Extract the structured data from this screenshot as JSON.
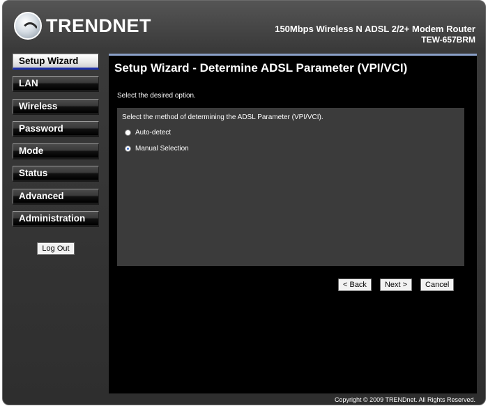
{
  "header": {
    "logo_text": "TRENDNET",
    "product_name": "150Mbps Wireless N ADSL 2/2+ Modem Router",
    "model": "TEW-657BRM"
  },
  "sidebar": {
    "items": [
      {
        "label": "Setup Wizard",
        "active": true
      },
      {
        "label": "LAN"
      },
      {
        "label": "Wireless"
      },
      {
        "label": "Password"
      },
      {
        "label": "Mode"
      },
      {
        "label": "Status"
      },
      {
        "label": "Advanced"
      },
      {
        "label": "Administration"
      }
    ],
    "logout_label": "Log Out"
  },
  "main": {
    "title": "Setup Wizard - Determine ADSL Parameter (VPI/VCI)",
    "instruction": "Select the desired option.",
    "box_label": "Select the method of determining the ADSL Parameter (VPI/VCI).",
    "options": [
      {
        "label": "Auto-detect",
        "selected": false
      },
      {
        "label": "Manual Selection",
        "selected": true
      }
    ],
    "buttons": {
      "back": "< Back",
      "next": "Next >",
      "cancel": "Cancel"
    }
  },
  "footer": {
    "copyright": "Copyright © 2009 TRENDnet. All Rights Reserved."
  }
}
